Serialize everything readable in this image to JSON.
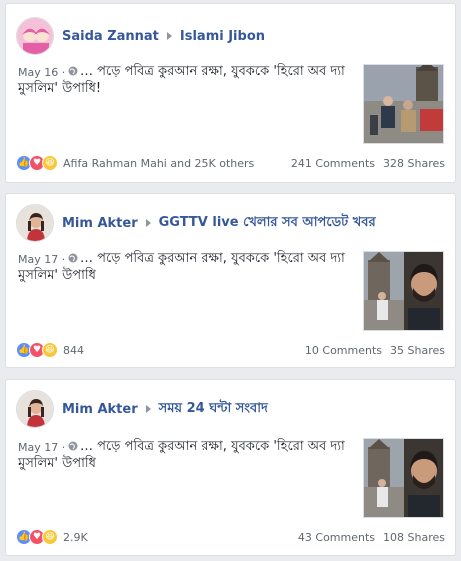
{
  "posts": [
    {
      "author": "Saida Zannat",
      "target": "Islami Jibon",
      "date": "May 16 ·",
      "text": "… পড়ে পবিত্র কুরআন রক্ষা, যুবককে 'হিরো অব দ্যা মুসলিম' উপাধি!",
      "reactions_text": "Afifa Rahman Mahi and 25K others",
      "comments": "241 Comments",
      "shares": "328 Shares"
    },
    {
      "author": "Mim Akter",
      "target": "GGTTV live খেলার সব আপডেট খবর",
      "date": "May 17 ·",
      "text": "… পড়ে পবিত্র কুরআন রক্ষা, যুবককে 'হিরো অব দ্যা মুসলিম' উপাধি",
      "reactions_text": "844",
      "comments": "10 Comments",
      "shares": "35 Shares"
    },
    {
      "author": "Mim Akter",
      "target": "সময় 24 ঘন্টা সংবাদ",
      "date": "May 17 ·",
      "text": "… পড়ে পবিত্র কুরআন রক্ষা, যুবককে 'হিরো অব দ্যা মুসলিম' উপাধি",
      "reactions_text": "2.9K",
      "comments": "43 Comments",
      "shares": "108 Shares"
    }
  ],
  "colors": {
    "link": "#365899",
    "meta": "#616770",
    "like": "#5890ff",
    "love": "#f25268",
    "haha": "#f7c83b"
  },
  "icons": [
    "arrow-icon",
    "globe-icon",
    "like-icon",
    "love-icon",
    "haha-icon"
  ]
}
